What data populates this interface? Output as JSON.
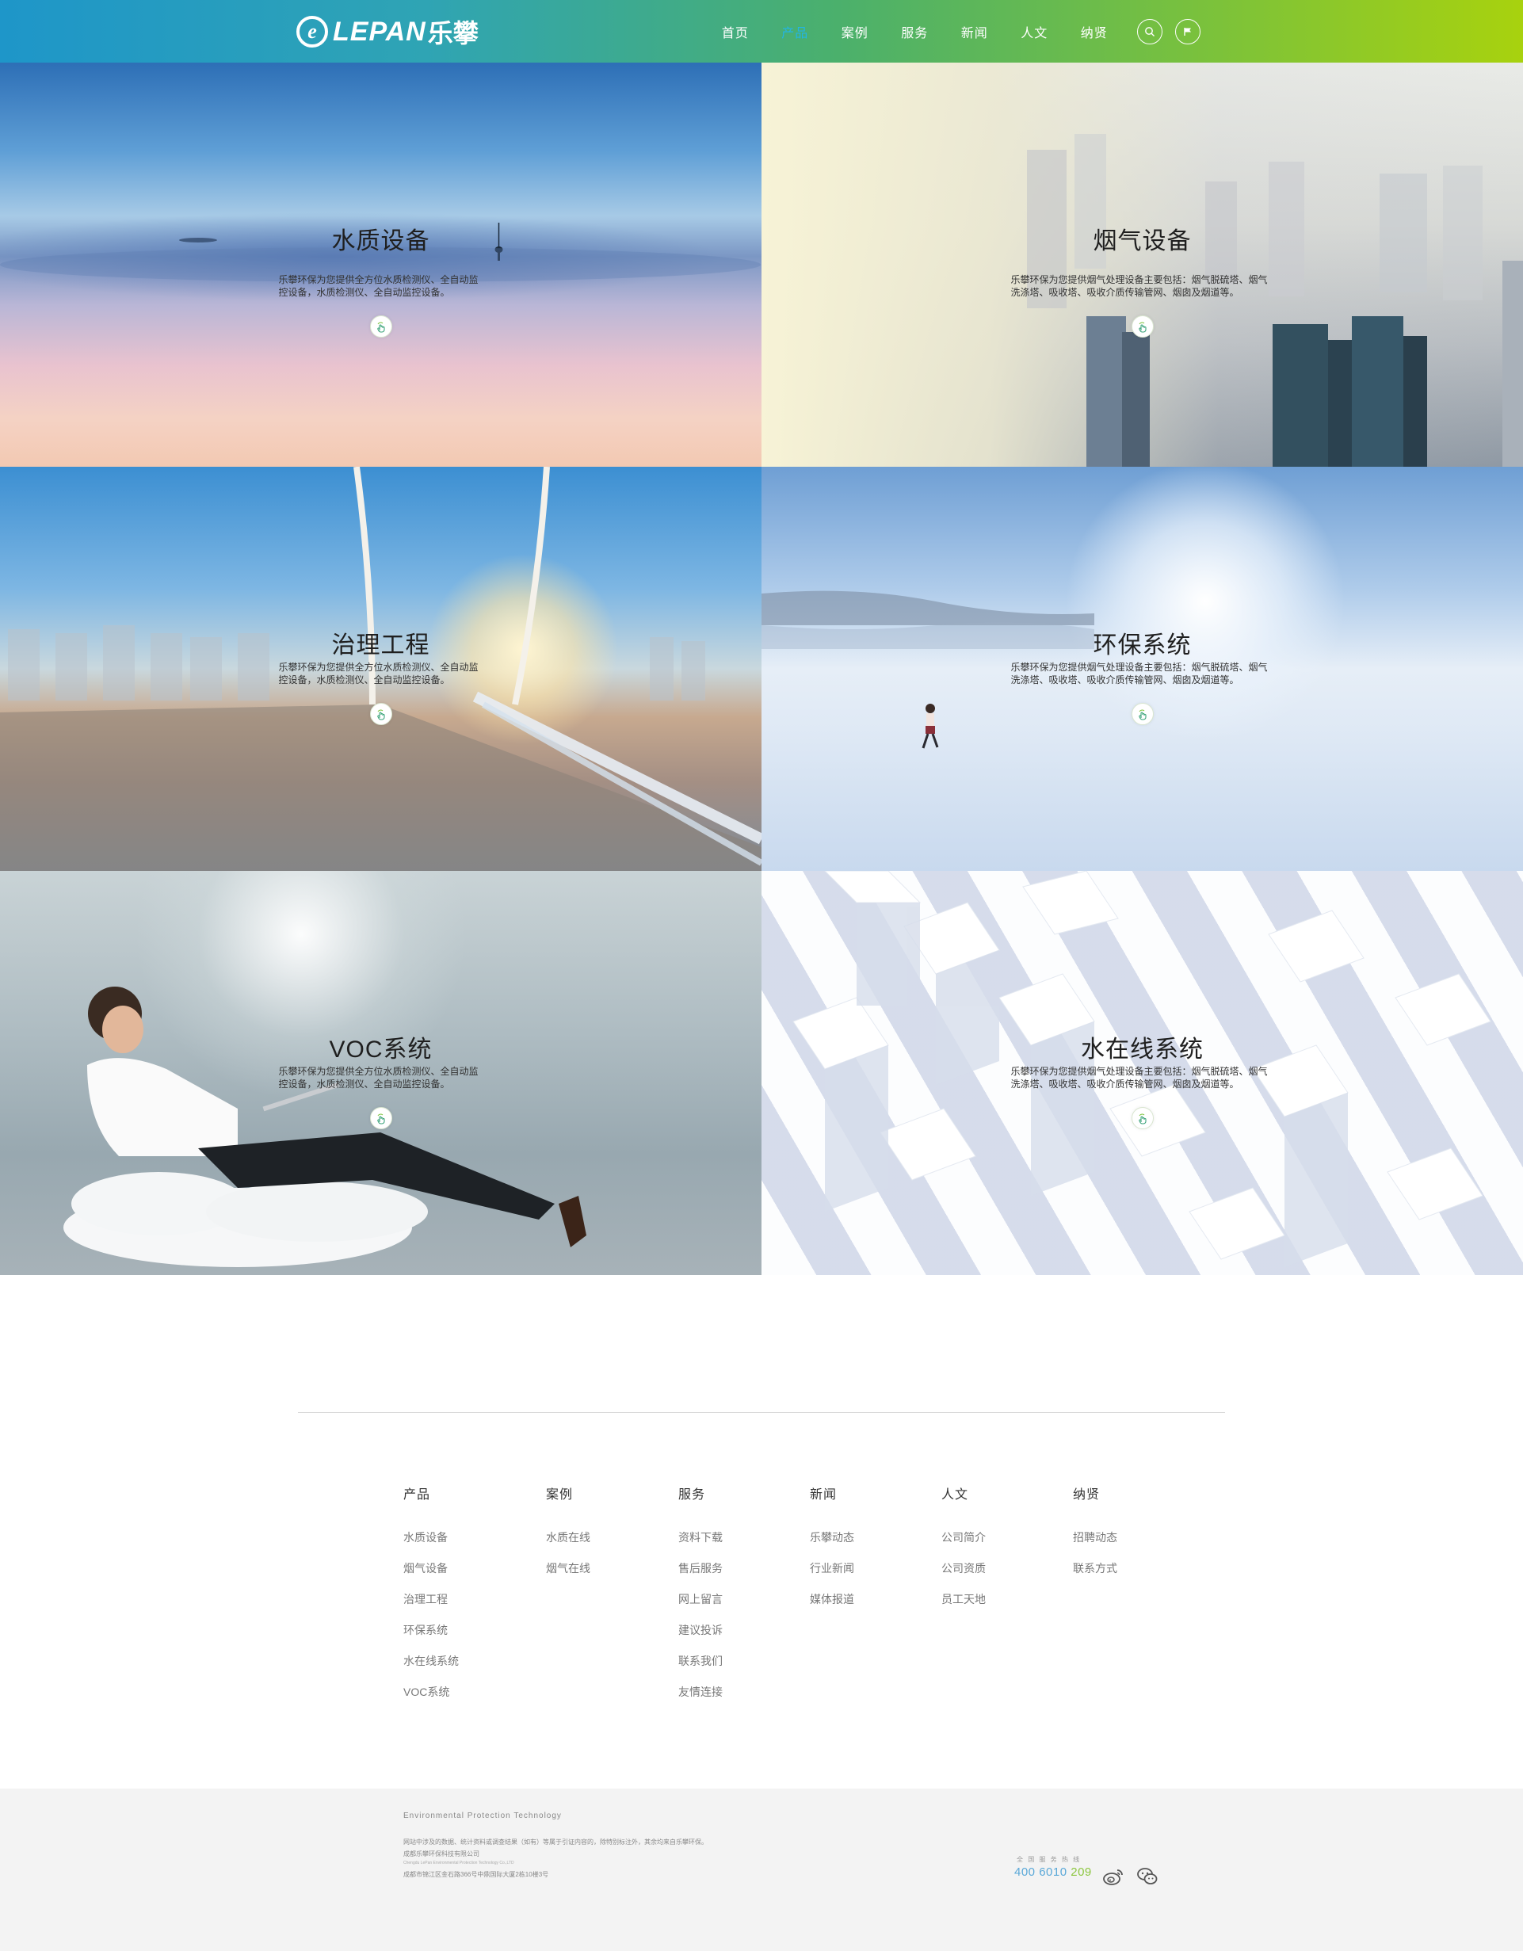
{
  "header": {
    "logo_letter": "e",
    "logo_text": "LEPAN",
    "logo_cn": "乐攀",
    "nav": [
      {
        "label": "首页",
        "active": false
      },
      {
        "label": "产品",
        "active": true
      },
      {
        "label": "案例",
        "active": false
      },
      {
        "label": "服务",
        "active": false
      },
      {
        "label": "新闻",
        "active": false
      },
      {
        "label": "人文",
        "active": false
      },
      {
        "label": "纳贤",
        "active": false
      }
    ],
    "icons": [
      "search-icon",
      "flag-icon"
    ],
    "active_color": "#22b5e5"
  },
  "tiles": [
    {
      "title": "水质设备",
      "desc": "乐攀环保为您提供全方位水质检测仪、全自动监控设备，水质检测仪、全自动监控设备。",
      "icon": "hand-pointer-icon"
    },
    {
      "title": "烟气设备",
      "desc": "乐攀环保为您提供烟气处理设备主要包括：烟气脱硫塔、烟气洗涤塔、吸收塔、吸收介质传输管网、烟囱及烟道等。",
      "icon": "hand-pointer-icon"
    },
    {
      "title": "治理工程",
      "desc": "乐攀环保为您提供全方位水质检测仪、全自动监控设备，水质检测仪、全自动监控设备。",
      "icon": "hand-pointer-icon"
    },
    {
      "title": "环保系统",
      "desc": "乐攀环保为您提供烟气处理设备主要包括：烟气脱硫塔、烟气洗涤塔、吸收塔、吸收介质传输管网、烟囱及烟道等。",
      "icon": "hand-pointer-icon"
    },
    {
      "title": "VOC系统",
      "desc": "乐攀环保为您提供全方位水质检测仪、全自动监控设备，水质检测仪、全自动监控设备。",
      "icon": "hand-pointer-icon"
    },
    {
      "title": "水在线系统",
      "desc": "乐攀环保为您提供烟气处理设备主要包括：烟气脱硫塔、烟气洗涤塔、吸收塔、吸收介质传输管网、烟囱及烟道等。",
      "icon": "hand-pointer-icon"
    }
  ],
  "footer": {
    "columns": [
      {
        "title": "产品",
        "items": [
          "水质设备",
          "烟气设备",
          "治理工程",
          "环保系统",
          "水在线系统",
          "VOC系统"
        ]
      },
      {
        "title": "案例",
        "items": [
          "水质在线",
          "烟气在线"
        ]
      },
      {
        "title": "服务",
        "items": [
          "资料下载",
          "售后服务",
          "网上留言",
          "建议投诉",
          "联系我们",
          "友情连接"
        ]
      },
      {
        "title": "新闻",
        "items": [
          "乐攀动态",
          "行业新闻",
          "媒体报道"
        ]
      },
      {
        "title": "人文",
        "items": [
          "公司简介",
          "公司资质",
          "员工天地"
        ]
      },
      {
        "title": "纳贤",
        "items": [
          "招聘动态",
          "联系方式"
        ]
      }
    ],
    "bottom": {
      "tagline_en": "Environmental  Protection  Technology",
      "notice": "网站中涉及的数据、统计资料或调查结果（如有）等属于引证内容的，除特别标注外，其余均来自乐攀环保。",
      "company": "成都乐攀环保科技有限公司",
      "company_en": "Chengdu LePan Environmental Protection Technology Co.,LTD",
      "address": "成都市锦江区金石路366号中鼎国际大厦2栋10楼3号",
      "hotline_label": "全 国 服 务 热 线",
      "hotline_blue": "400 6010",
      "hotline_green": "209",
      "social_icons": [
        "weibo-icon",
        "wechat-icon"
      ]
    }
  }
}
